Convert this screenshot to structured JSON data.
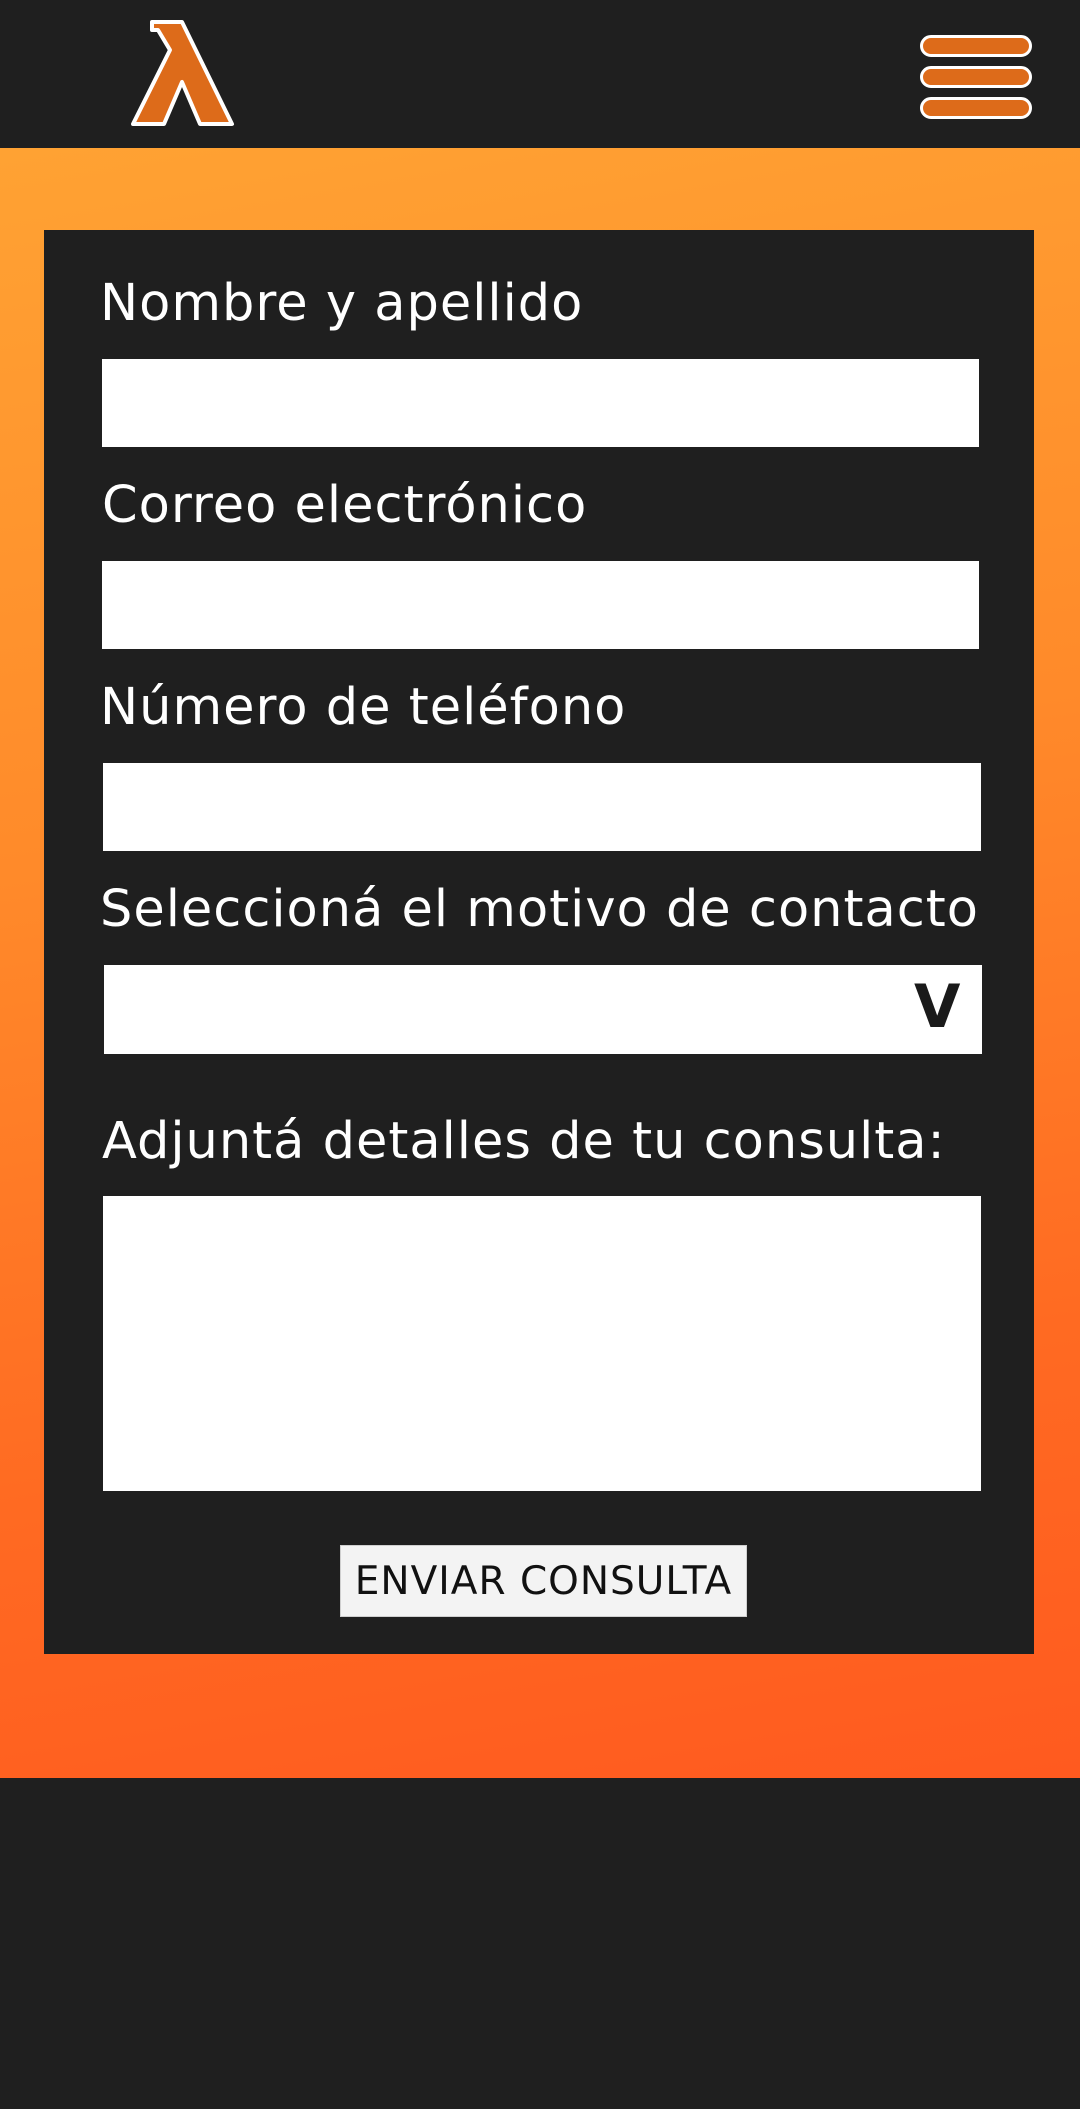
{
  "header": {
    "logo_icon": "lambda-logo-icon",
    "menu_icon": "hamburger-menu-icon",
    "accent_color": "#dd6b1a"
  },
  "form": {
    "name_label": "Nombre y apellido",
    "name_value": "",
    "email_label": "Correo electrónico",
    "email_value": "",
    "phone_label": "Número de teléfono",
    "phone_value": "",
    "reason_label": "Seleccioná el motivo de contacto",
    "reason_selected": "",
    "reason_arrow": "V",
    "details_label": "Adjuntá detalles de tu consulta:",
    "details_value": "",
    "submit_label": "ENVIAR CONSULTA"
  },
  "colors": {
    "background_dark": "#1f1f1f",
    "gradient_top": "#ffa233",
    "gradient_bottom": "#ff5a1f"
  }
}
